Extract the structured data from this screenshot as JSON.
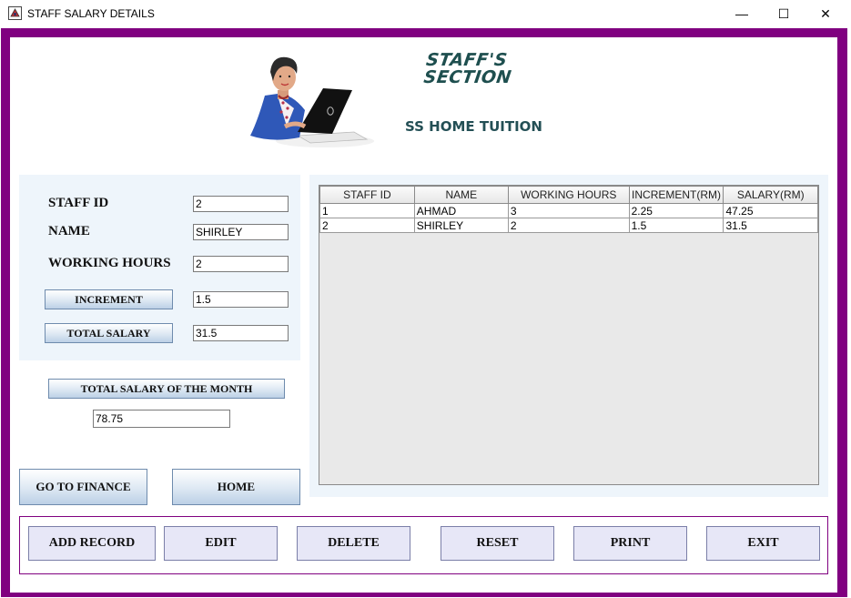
{
  "window": {
    "title": "STAFF SALARY DETAILS",
    "minimize_glyph": "—",
    "maximize_glyph": "☐",
    "close_glyph": "✕"
  },
  "banner": {
    "title_line1": "STAFF'S",
    "title_line2": "SECTION",
    "subtitle": "SS HOME TUITION"
  },
  "form": {
    "staff_id_label": "STAFF ID",
    "staff_id_value": "2",
    "name_label": "NAME",
    "name_value": "SHIRLEY",
    "working_hours_label": "WORKING HOURS",
    "working_hours_value": "2",
    "increment_button": "INCREMENT",
    "increment_value": "1.5",
    "total_salary_button": "TOTAL SALARY",
    "total_salary_value": "31.5",
    "month_total_button": "TOTAL SALARY OF THE MONTH",
    "month_total_value": "78.75"
  },
  "nav": {
    "finance_button": "GO TO FINANCE",
    "home_button": "HOME"
  },
  "table": {
    "columns": [
      "STAFF ID",
      "NAME",
      "WORKING HOURS",
      "INCREMENT(RM)",
      "SALARY(RM)"
    ],
    "rows": [
      [
        "1",
        "AHMAD",
        "3",
        "2.25",
        "47.25"
      ],
      [
        "2",
        "SHIRLEY",
        "2",
        "1.5",
        "31.5"
      ]
    ]
  },
  "actions": {
    "add": "ADD RECORD",
    "edit": "EDIT",
    "delete": "DELETE",
    "reset": "RESET",
    "print": "PRINT",
    "exit": "EXIT"
  },
  "colors": {
    "frame": "#800080",
    "panel": "#eef5fb",
    "brand_text": "#1e4f4f"
  }
}
